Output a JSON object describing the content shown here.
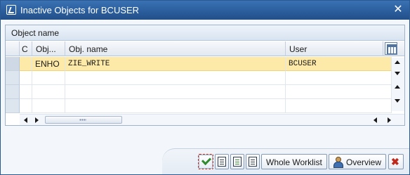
{
  "window": {
    "title": "Inactive Objects for BCUSER",
    "close_glyph": "✕"
  },
  "table": {
    "title": "Object name",
    "columns": [
      "C",
      "Obj...",
      "Obj. name",
      "User"
    ],
    "rows": [
      {
        "obj": "ENHO",
        "name": "ZIE_WRITE",
        "user": "BCUSER",
        "highlighted": true
      },
      {
        "obj": "",
        "name": "",
        "user": ""
      },
      {
        "obj": "",
        "name": "",
        "user": ""
      },
      {
        "obj": "",
        "name": "",
        "user": ""
      }
    ]
  },
  "buttons": {
    "whole_worklist": "Whole Worklist",
    "overview": "Overview"
  },
  "icons": [
    "check-icon",
    "object-icon",
    "activate-icon",
    "document-icon",
    "overview-person-icon",
    "cancel-x-icon",
    "column-settings-icon"
  ],
  "colors": {
    "title_bar": "#2a5c9b",
    "highlight_row": "#fde9a8",
    "check_green": "#2f8a2f",
    "cancel_red": "#c0281b"
  }
}
